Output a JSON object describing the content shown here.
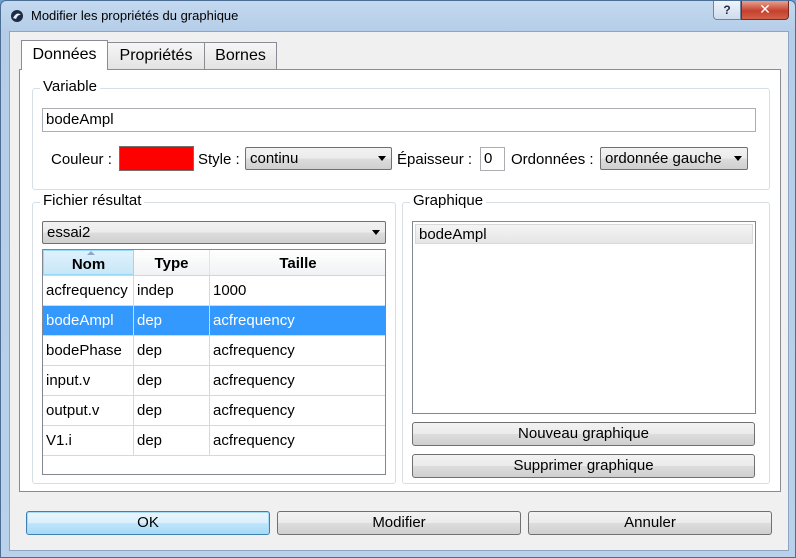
{
  "window": {
    "title": "Modifier les propriétés du graphique",
    "help_label": "?",
    "close_label": "✕"
  },
  "tabs": [
    {
      "label": "Données",
      "active": true
    },
    {
      "label": "Propriétés",
      "active": false
    },
    {
      "label": "Bornes",
      "active": false
    }
  ],
  "variable": {
    "group_title": "Variable",
    "name_value": "bodeAmpl",
    "color_label": "Couleur :",
    "color_value": "#ff0000",
    "style_label": "Style :",
    "style_value": "continu",
    "thickness_label": "Épaisseur :",
    "thickness_value": "0",
    "ordinates_label": "Ordonnées :",
    "ordinates_value": "ordonnée gauche"
  },
  "result_file": {
    "group_title": "Fichier résultat",
    "file_value": "essai2",
    "columns": [
      "Nom",
      "Type",
      "Taille"
    ],
    "rows": [
      {
        "name": "acfrequency",
        "type": "indep",
        "size": "1000",
        "selected": false
      },
      {
        "name": "bodeAmpl",
        "type": "dep",
        "size": "acfrequency",
        "selected": true
      },
      {
        "name": "bodePhase",
        "type": "dep",
        "size": "acfrequency",
        "selected": false
      },
      {
        "name": "input.v",
        "type": "dep",
        "size": "acfrequency",
        "selected": false
      },
      {
        "name": "output.v",
        "type": "dep",
        "size": "acfrequency",
        "selected": false
      },
      {
        "name": "V1.i",
        "type": "dep",
        "size": "acfrequency",
        "selected": false
      }
    ]
  },
  "graphic": {
    "group_title": "Graphique",
    "items": [
      "bodeAmpl"
    ],
    "new_button": "Nouveau graphique",
    "delete_button": "Supprimer graphique"
  },
  "footer": {
    "ok": "OK",
    "modify": "Modifier",
    "cancel": "Annuler"
  },
  "icons": {
    "app": "app-logo-icon",
    "sort": "sort-up-icon",
    "dropdown": "chevron-down-icon"
  }
}
